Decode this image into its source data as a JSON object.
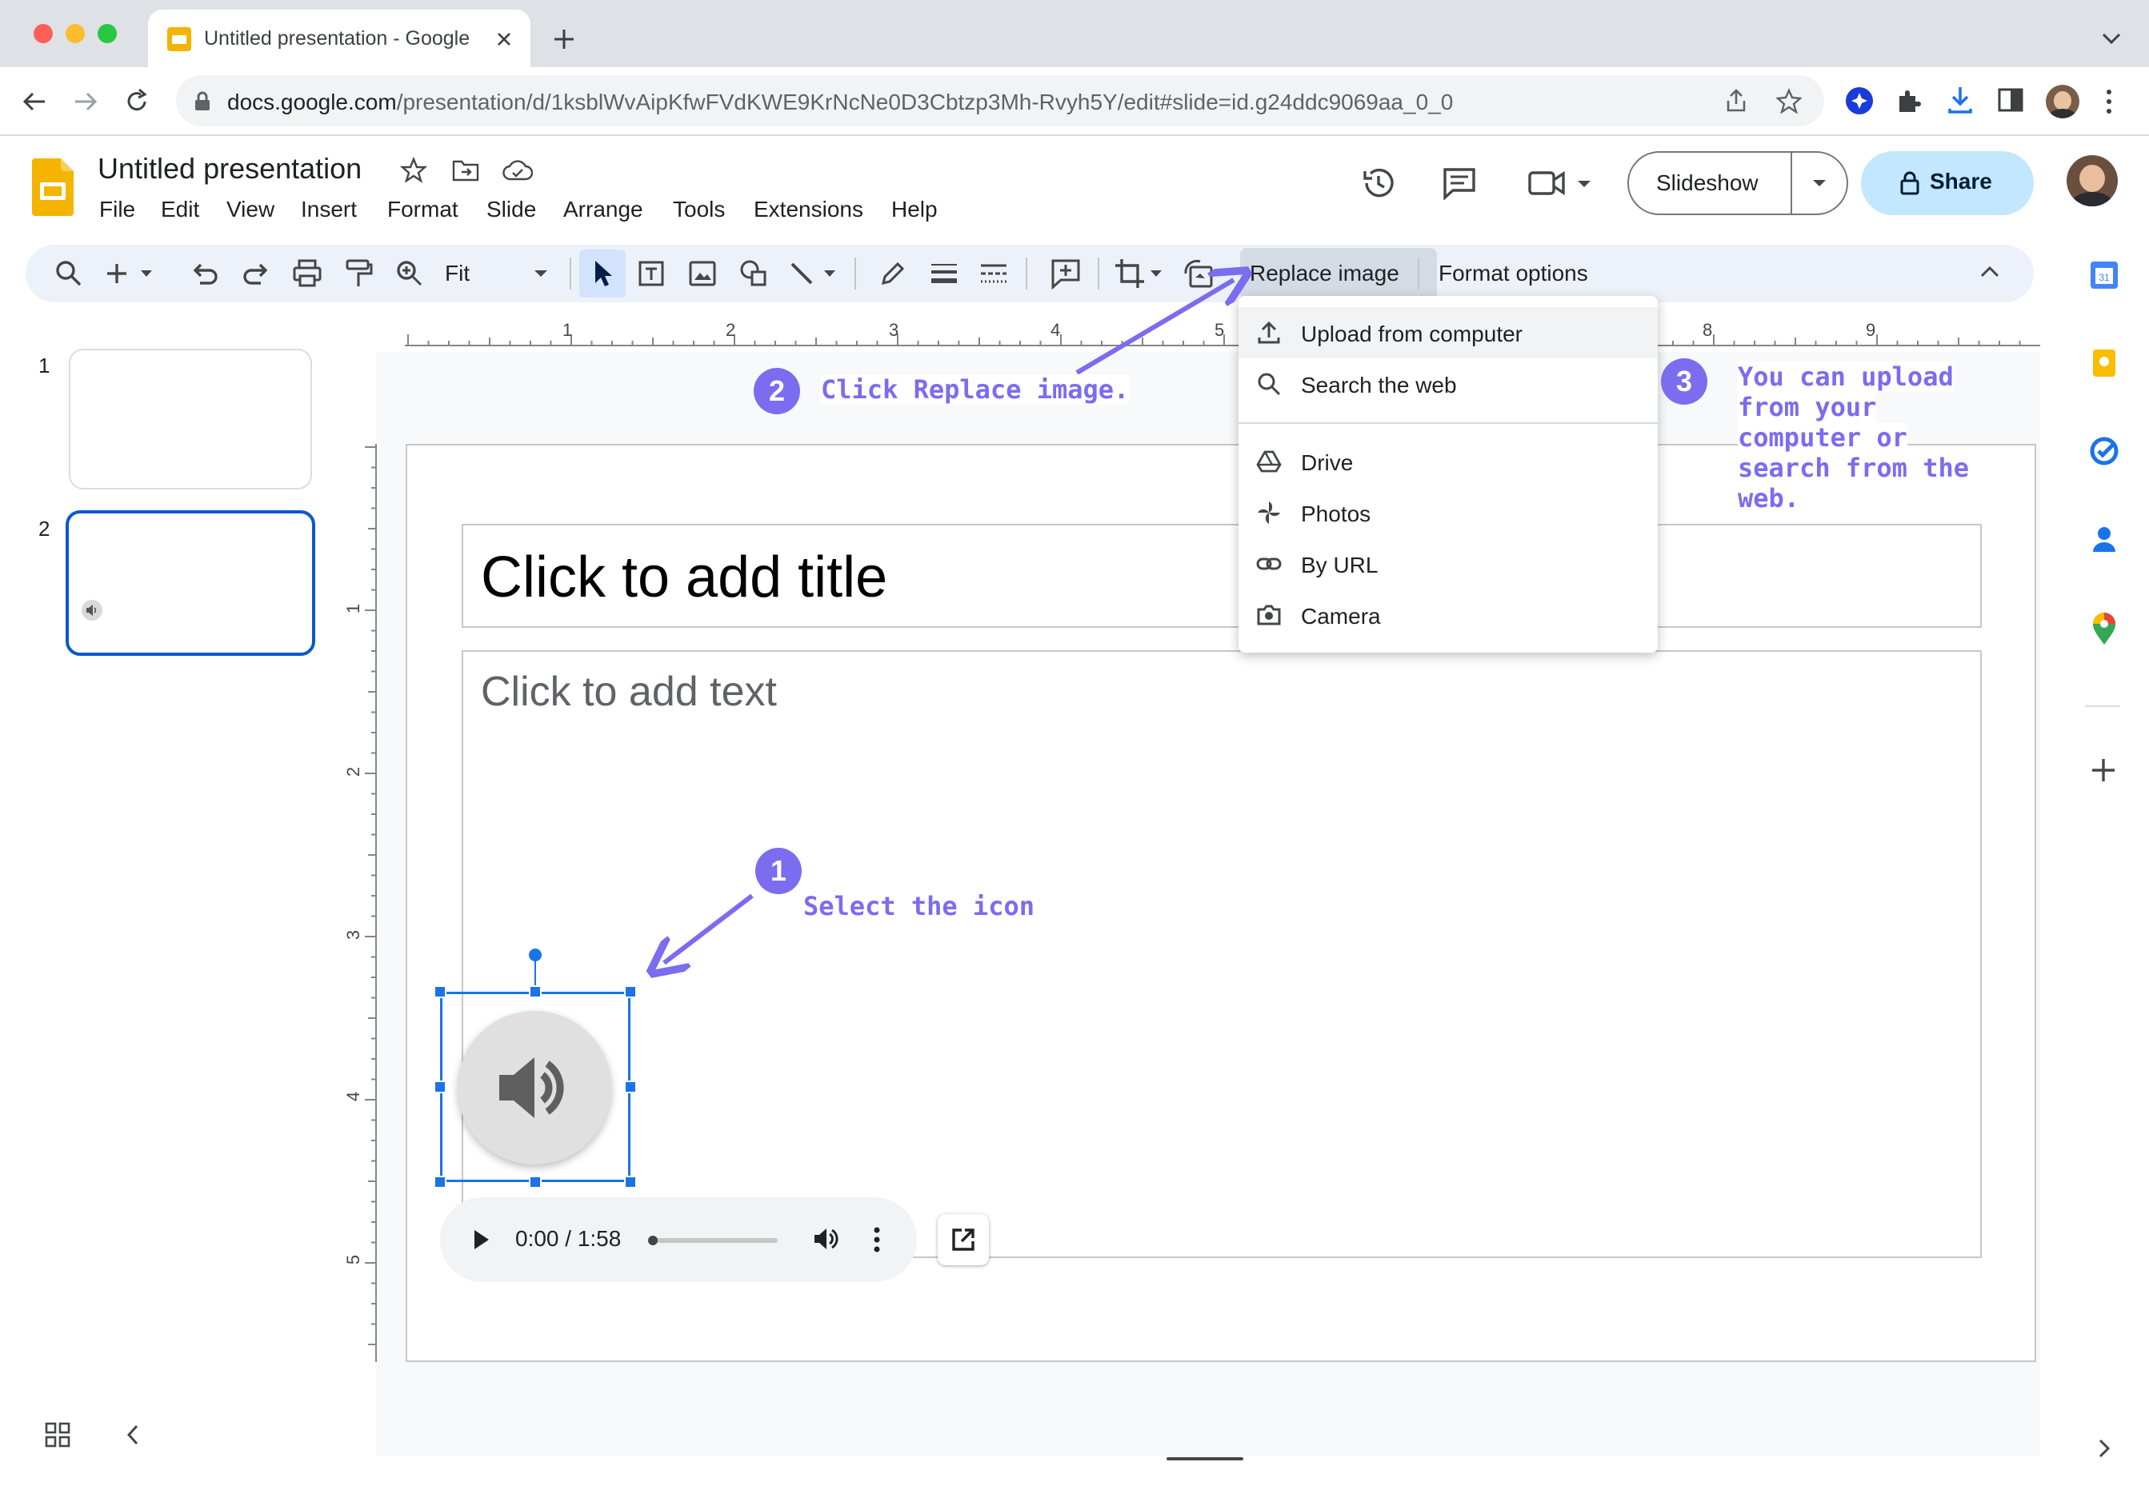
{
  "browser": {
    "tab_title": "Untitled presentation - Google Slides",
    "url_host": "docs.google.com",
    "url_path": "/presentation/d/1ksblWvAipKfwFVdKWE9KrNcNe0D3Cbtzp3Mh-Rvyh5Y/edit#slide=id.g24ddc9069aa_0_0",
    "traffic_light_colors": [
      "#ff5f57",
      "#febc2e",
      "#28c840"
    ]
  },
  "doc": {
    "title": "Untitled presentation",
    "menus": [
      "File",
      "Edit",
      "View",
      "Insert",
      "Format",
      "Slide",
      "Arrange",
      "Tools",
      "Extensions",
      "Help"
    ],
    "slideshow_label": "Slideshow",
    "share_label": "Share"
  },
  "toolbar": {
    "zoom": "Fit",
    "replace_image_label": "Replace image",
    "format_options_label": "Format options"
  },
  "filmstrip": {
    "slides": [
      "1",
      "2"
    ],
    "selected": "2"
  },
  "slide": {
    "title_placeholder": "Click to add title",
    "body_placeholder": "Click to add text"
  },
  "replace_menu": {
    "items": [
      "Upload from computer",
      "Search the web",
      "Drive",
      "Photos",
      "By URL",
      "Camera"
    ],
    "icons": [
      "upload-icon",
      "search-icon",
      "drive-icon",
      "photos-icon",
      "link-icon",
      "camera-icon"
    ]
  },
  "annotations": {
    "step1_number": "1",
    "step1_text": "Select the icon",
    "step2_number": "2",
    "step2_text": "Click Replace image.",
    "step3_number": "3",
    "step3_lines": [
      "You can upload",
      "from your",
      "computer or",
      "search from the",
      "web."
    ],
    "accent_color": "#7b6cf0"
  },
  "audio_player": {
    "time": "0:00 / 1:58",
    "progress": 0.0
  },
  "ruler": {
    "horizontal_labels": [
      "1",
      "2",
      "3",
      "4",
      "5",
      "8",
      "9"
    ],
    "vertical_labels": [
      "1",
      "2",
      "3",
      "4",
      "5"
    ]
  }
}
